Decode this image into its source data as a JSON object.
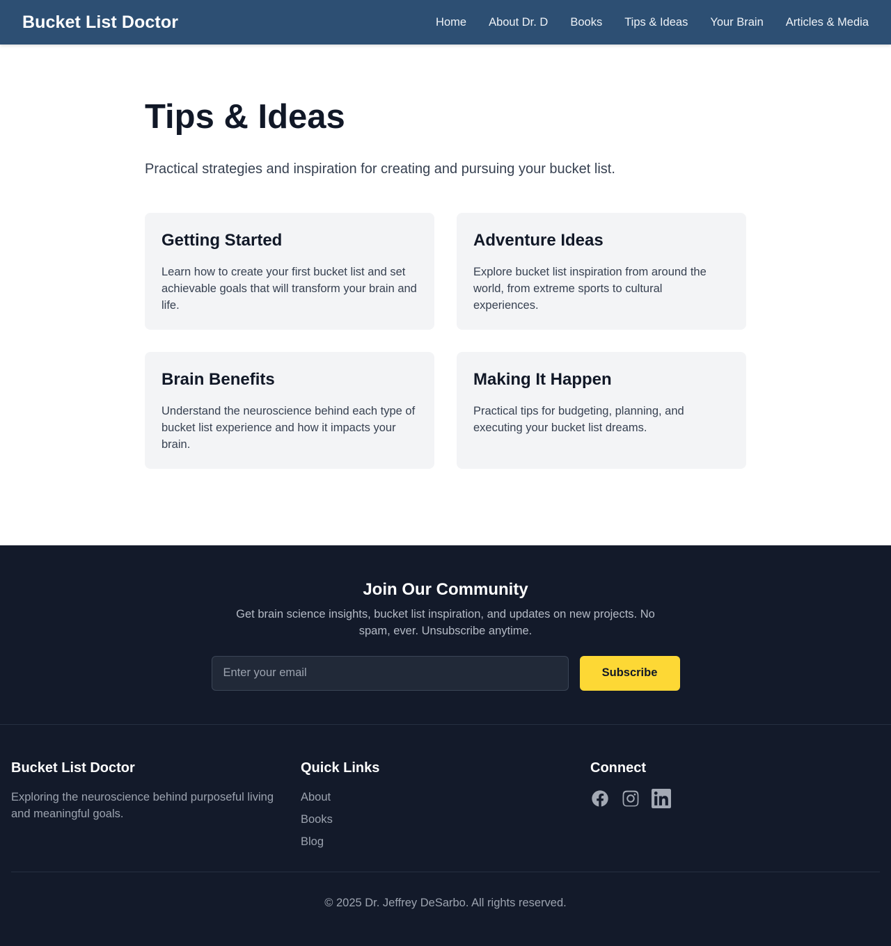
{
  "header": {
    "brand": "Bucket List Doctor",
    "nav": [
      "Home",
      "About Dr. D",
      "Books",
      "Tips & Ideas",
      "Your Brain",
      "Articles & Media"
    ]
  },
  "main": {
    "title": "Tips & Ideas",
    "subtitle": "Practical strategies and inspiration for creating and pursuing your bucket list.",
    "cards": [
      {
        "title": "Getting Started",
        "text": "Learn how to create your first bucket list and set achievable goals that will transform your brain and life."
      },
      {
        "title": "Adventure Ideas",
        "text": "Explore bucket list inspiration from around the world, from extreme sports to cultural experiences."
      },
      {
        "title": "Brain Benefits",
        "text": "Understand the neuroscience behind each type of bucket list experience and how it impacts your brain."
      },
      {
        "title": "Making It Happen",
        "text": "Practical tips for budgeting, planning, and executing your bucket list dreams."
      }
    ]
  },
  "newsletter": {
    "title": "Join Our Community",
    "text": "Get brain science insights, bucket list inspiration, and updates on new projects. No spam, ever. Unsubscribe anytime.",
    "email_placeholder": "Enter your email",
    "subscribe_label": "Subscribe"
  },
  "footer": {
    "about_title": "Bucket List Doctor",
    "about_text": "Exploring the neuroscience behind purposeful living and meaningful goals.",
    "links_title": "Quick Links",
    "links": [
      "About",
      "Books",
      "Blog"
    ],
    "connect_title": "Connect",
    "social_icons": [
      "facebook-icon",
      "instagram-icon",
      "linkedin-icon"
    ],
    "copyright": "© 2025 Dr. Jeffrey DeSarbo. All rights reserved."
  },
  "colors": {
    "header_bg": "#2d4f73",
    "footer_bg": "#131a2a",
    "card_bg": "#f3f4f6",
    "accent": "#fdd835"
  }
}
